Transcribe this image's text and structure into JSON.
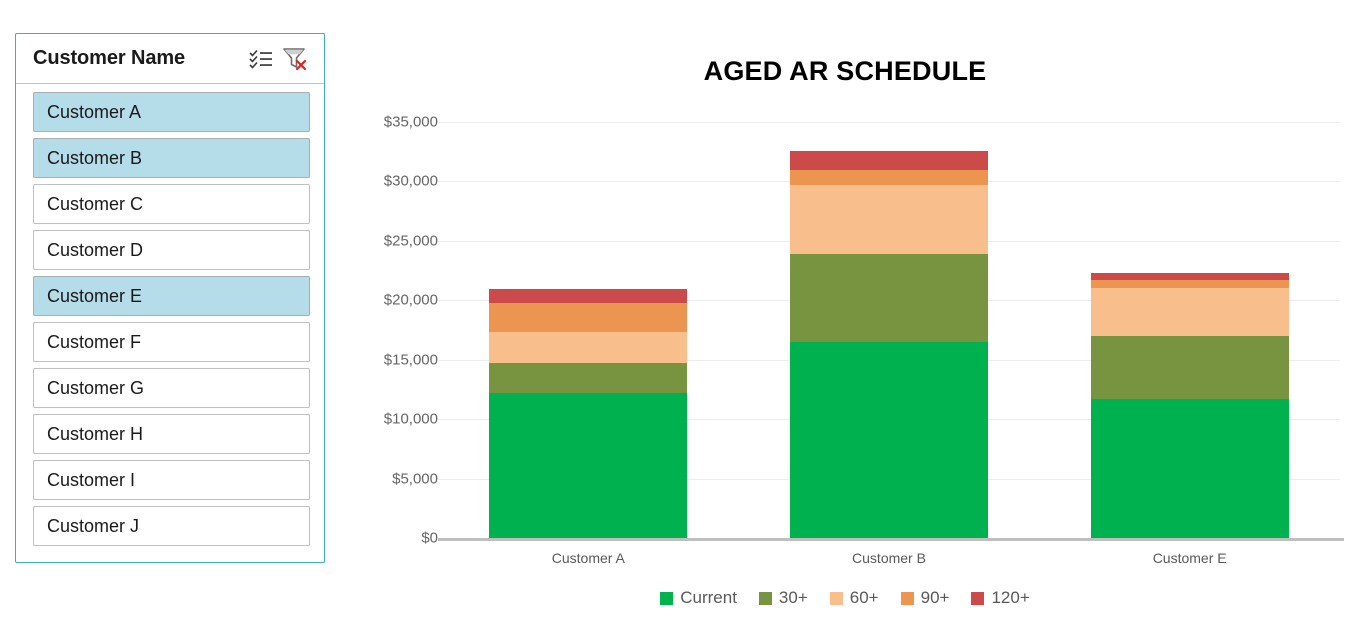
{
  "slicer": {
    "title": "Customer Name",
    "icons": [
      {
        "name": "multi-select-icon"
      },
      {
        "name": "clear-filter-icon"
      }
    ],
    "items": [
      {
        "label": "Customer A",
        "selected": true
      },
      {
        "label": "Customer B",
        "selected": true
      },
      {
        "label": "Customer C",
        "selected": false
      },
      {
        "label": "Customer D",
        "selected": false
      },
      {
        "label": "Customer E",
        "selected": true
      },
      {
        "label": "Customer F",
        "selected": false
      },
      {
        "label": "Customer G",
        "selected": false
      },
      {
        "label": "Customer H",
        "selected": false
      },
      {
        "label": "Customer I",
        "selected": false
      },
      {
        "label": "Customer J",
        "selected": false
      }
    ],
    "selected_fill": "#B5DCE9",
    "border_color": "#3FA9C6"
  },
  "chart_data": {
    "type": "bar",
    "stacked": true,
    "title": "AGED AR SCHEDULE",
    "xlabel": "",
    "ylabel": "",
    "categories": [
      "Customer A",
      "Customer B",
      "Customer E"
    ],
    "ylim": [
      0,
      35000
    ],
    "yticks": [
      0,
      5000,
      10000,
      15000,
      20000,
      25000,
      30000,
      35000
    ],
    "ytick_labels": [
      "$0",
      "$5,000",
      "$10,000",
      "$15,000",
      "$20,000",
      "$25,000",
      "$30,000",
      "$35,000"
    ],
    "grid": true,
    "legend_position": "bottom",
    "series": [
      {
        "name": "Current",
        "color": "#00B14F",
        "values": [
          12200,
          16500,
          11700
        ]
      },
      {
        "name": "30+",
        "color": "#789440",
        "values": [
          2550,
          7400,
          5300
        ]
      },
      {
        "name": "60+",
        "color": "#F8BE8C",
        "values": [
          2600,
          5800,
          4000
        ]
      },
      {
        "name": "90+",
        "color": "#EC9550",
        "values": [
          2450,
          1250,
          750
        ]
      },
      {
        "name": "120+",
        "color": "#CC4A4A",
        "values": [
          1150,
          1650,
          550
        ]
      }
    ],
    "totals": [
      20950,
      32600,
      22300
    ]
  }
}
